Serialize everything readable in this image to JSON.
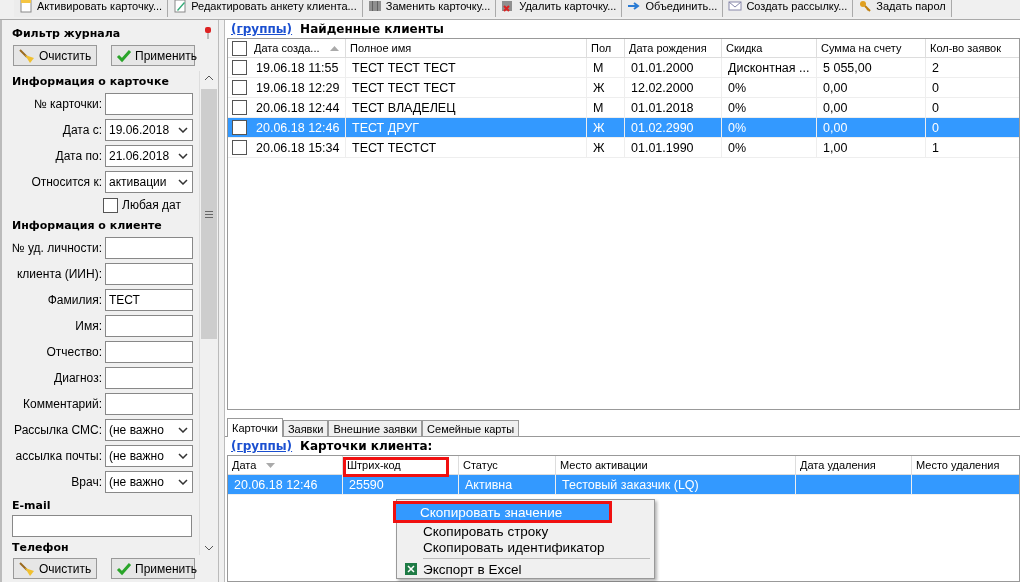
{
  "toolbar": {
    "buttons": [
      {
        "label": "Активировать карточку..."
      },
      {
        "label": "Редактировать анкету клиента..."
      },
      {
        "label": "Заменить карточку..."
      },
      {
        "label": "Удалить карточку..."
      },
      {
        "label": "Объединить..."
      },
      {
        "label": "Создать рассылку..."
      },
      {
        "label": "Задать парол"
      }
    ]
  },
  "filter": {
    "title": "Фильтр журнала",
    "clear_button": "Очистить",
    "apply_button": "Применить",
    "sections": [
      {
        "title": "Информация о карточке",
        "fields": [
          {
            "kind": "text",
            "label": "№ карточки:"
          },
          {
            "kind": "select",
            "label": "Дата с:",
            "value": "19.06.2018"
          },
          {
            "kind": "select",
            "label": "Дата по:",
            "value": "21.06.2018"
          },
          {
            "kind": "select",
            "label": "Относится к:",
            "value": "активации"
          },
          {
            "kind": "checkbox",
            "label": "Любая дат",
            "checked": false
          }
        ]
      },
      {
        "title": "Информация о клиенте",
        "fields": [
          {
            "kind": "text",
            "label": "№ уд. личности:"
          },
          {
            "kind": "text",
            "label": "клиента (ИИН):"
          },
          {
            "kind": "text",
            "label": "Фамилия:",
            "value": "ТЕСТ"
          },
          {
            "kind": "text",
            "label": "Имя:"
          },
          {
            "kind": "text",
            "label": "Отчество:"
          },
          {
            "kind": "text",
            "label": "Диагноз:"
          },
          {
            "kind": "text",
            "label": "Комментарий:"
          },
          {
            "kind": "select",
            "label": "Рассылка СМС:",
            "value": "(не важно"
          },
          {
            "kind": "select",
            "label": "ассылка почты:",
            "value": "(не важно"
          },
          {
            "kind": "select",
            "label": "Врач:",
            "value": "(не важно"
          }
        ]
      }
    ],
    "email_label": "E-mail",
    "phone_label": "Телефон",
    "bottom_clear_button": "Очистить",
    "bottom_apply_button": "Применить"
  },
  "clients": {
    "groups_link": "(группы)",
    "title": "Найденные клиенты",
    "all_checked": false,
    "columns": [
      "Дата созда...",
      "Полное имя",
      "Пол",
      "Дата рождения",
      "Скидка",
      "Сумма на счету",
      "Кол-во заявок"
    ],
    "rows": [
      {
        "selected": false,
        "checked": false,
        "cells": [
          "19.06.18 11:55",
          "ТЕСТ ТЕСТ ТЕСТ",
          "М",
          "01.01.2000",
          "Дисконтная ...",
          "5 055,00",
          "2"
        ]
      },
      {
        "selected": false,
        "checked": false,
        "cells": [
          "19.06.18 12:29",
          "ТЕСТ ТЕСТ ТЕСТ",
          "Ж",
          "12.02.2000",
          "0%",
          "0,00",
          "0"
        ]
      },
      {
        "selected": false,
        "checked": false,
        "cells": [
          "20.06.18 12:44",
          "ТЕСТ ВЛАДЕЛЕЦ",
          "М",
          "01.01.2018",
          "0%",
          "0,00",
          "0"
        ]
      },
      {
        "selected": true,
        "checked": false,
        "cells": [
          "20.06.18 12:46",
          "ТЕСТ ДРУГ",
          "Ж",
          "01.02.2990",
          "0%",
          "0,00",
          "0"
        ]
      },
      {
        "selected": false,
        "checked": false,
        "cells": [
          "20.06.18 15:34",
          "ТЕСТ ТЕСТСТ",
          "Ж",
          "01.01.1990",
          "0%",
          "1,00",
          "1"
        ]
      }
    ]
  },
  "tabs": [
    {
      "label": "Карточки",
      "selected": true
    },
    {
      "label": "Заявки",
      "selected": false
    },
    {
      "label": "Внешние заявки",
      "selected": false
    },
    {
      "label": "Семейные карты",
      "selected": false
    }
  ],
  "cards": {
    "groups_link": "(группы)",
    "title": "Карточки клиента:",
    "columns": [
      "Дата",
      "Штрих-код",
      "Статус",
      "Место активации",
      "Дата удаления",
      "Место удаления"
    ],
    "rows": [
      {
        "selected": true,
        "cells": [
          "20.06.18 12:46",
          "25590",
          "Активна",
          "Тестовый заказчик (LQ)",
          null,
          null
        ]
      }
    ]
  },
  "context_menu": {
    "items": [
      {
        "label": "Скопировать значение",
        "selected": true
      },
      {
        "label": "Скопировать строку",
        "selected": false
      },
      {
        "label": "Скопировать идентификатор",
        "selected": false
      },
      {
        "label": "Экспорт в Excel",
        "selected": false,
        "separator_before": true
      }
    ]
  }
}
